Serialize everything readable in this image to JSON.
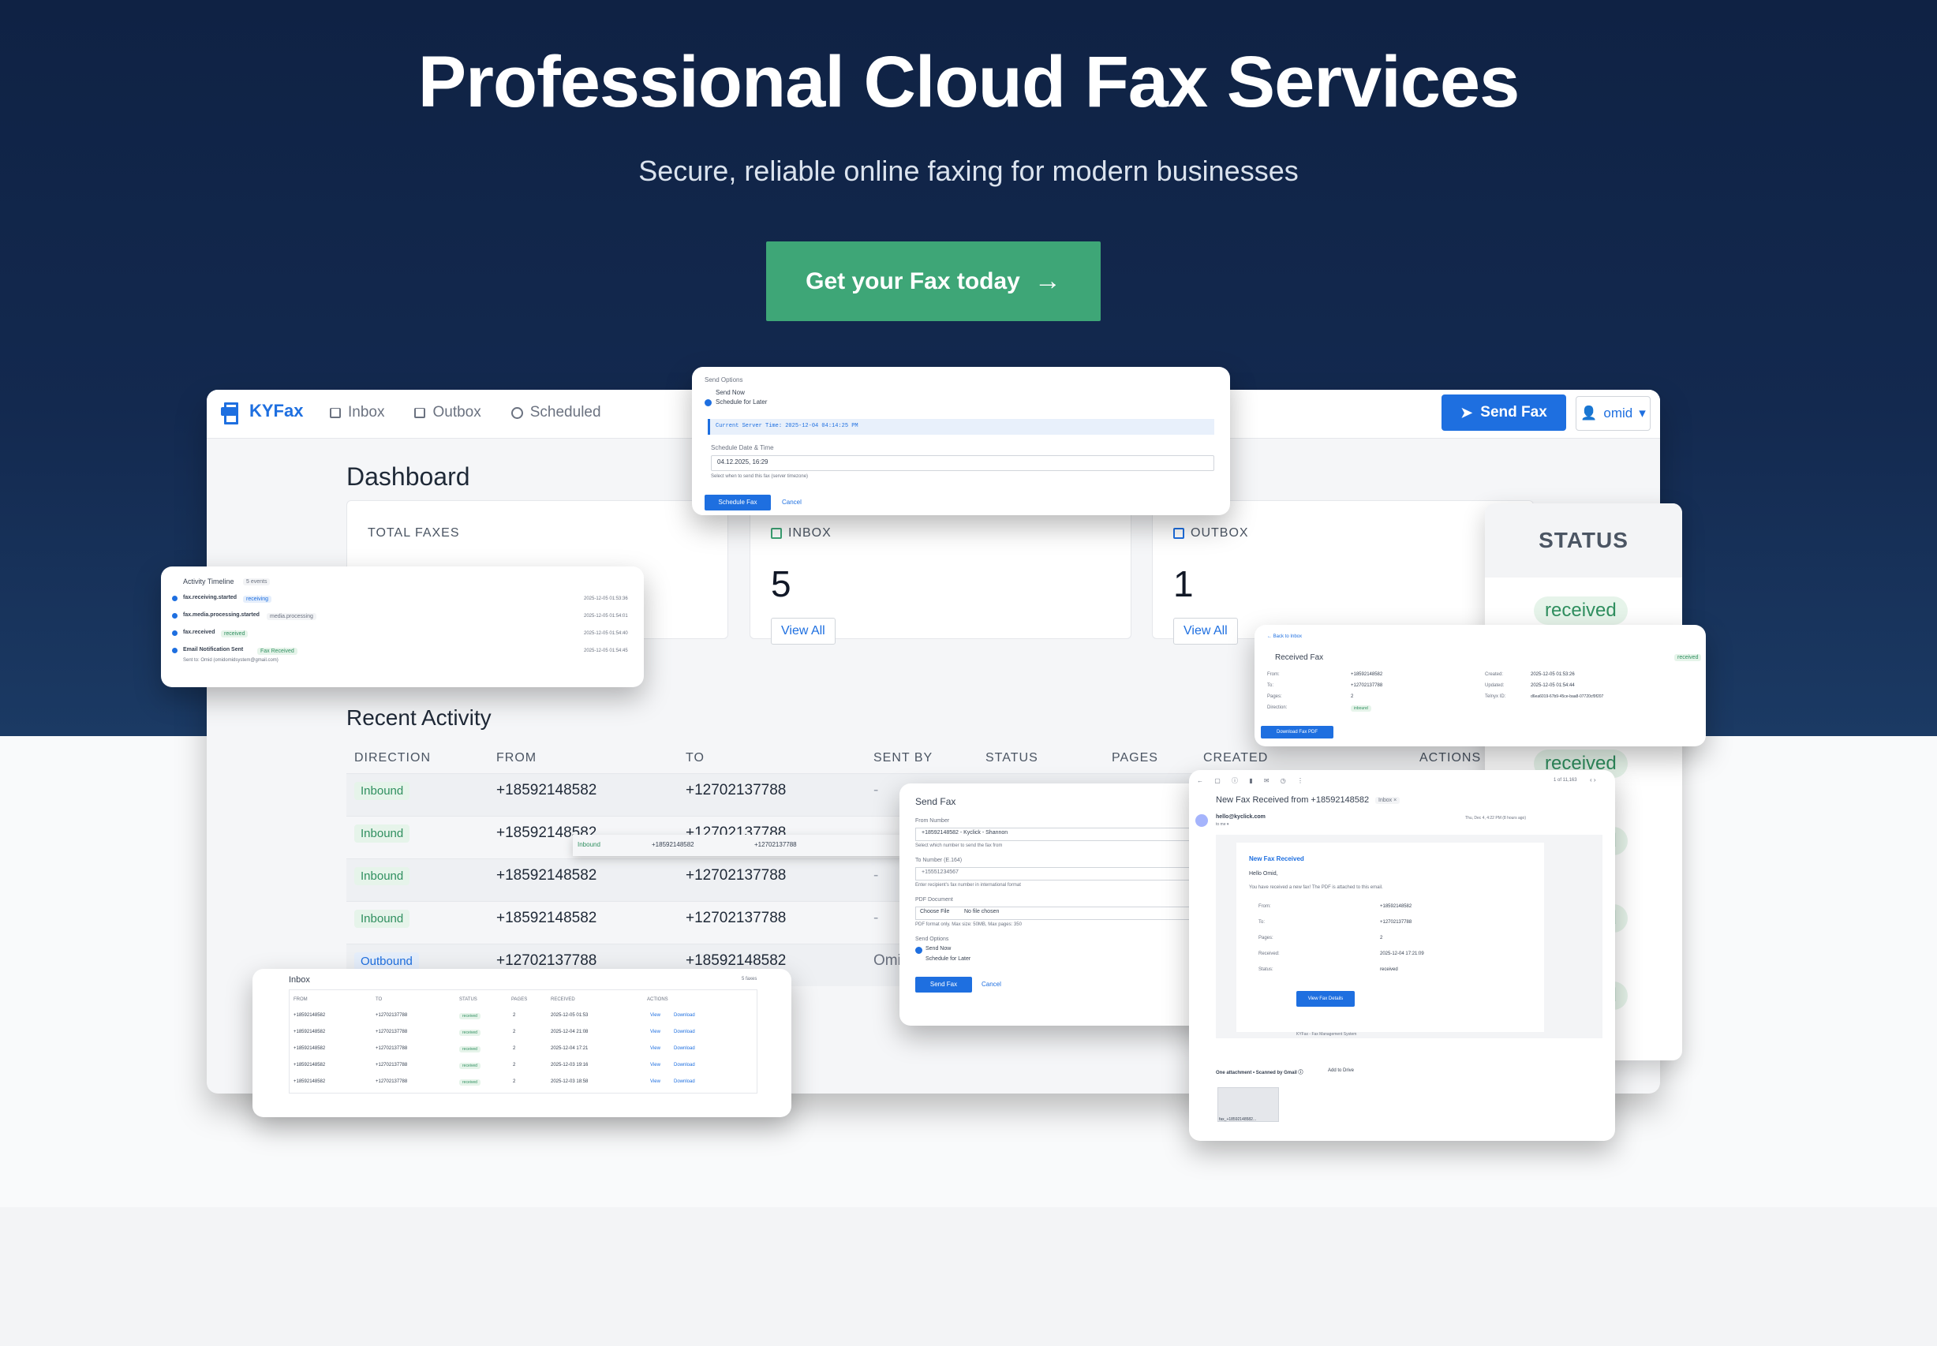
{
  "hero": {
    "title": "Professional Cloud Fax Services",
    "subtitle": "Secure, reliable online faxing for modern businesses",
    "cta_label": "Get your Fax today",
    "cta_icon": "arrow-right-icon",
    "accent_color": "#3ea677"
  },
  "dashboard": {
    "brand": "KYFax",
    "nav": [
      "Inbox",
      "Outbox",
      "Scheduled"
    ],
    "send_fax_label": "Send Fax",
    "user_label": "omid",
    "title": "Dashboard",
    "stats": [
      {
        "label": "TOTAL FAXES",
        "value": ""
      },
      {
        "label": "INBOX",
        "value": "5",
        "link": "View All"
      },
      {
        "label": "OUTBOX",
        "value": "1",
        "link": "View All"
      }
    ],
    "recent_activity_title": "Recent Activity",
    "columns": [
      "DIRECTION",
      "FROM",
      "TO",
      "SENT BY",
      "STATUS",
      "PAGES",
      "CREATED",
      "ACTIONS"
    ],
    "rows": [
      {
        "direction": "Inbound",
        "from": "+18592148582",
        "to": "+12702137788",
        "sent_by": "-"
      },
      {
        "direction": "Inbound",
        "from": "+18592148582",
        "to": "+12702137788",
        "sent_by": ""
      },
      {
        "direction": "Inbound",
        "from": "+18592148582",
        "to": "+12702137788",
        "sent_by": "-"
      },
      {
        "direction": "Inbound",
        "from": "+18592148582",
        "to": "+12702137788",
        "sent_by": "-"
      },
      {
        "direction": "Outbound",
        "from": "+12702137788",
        "to": "+18592148582",
        "sent_by": "Omid"
      }
    ],
    "status_header": "STATUS",
    "status_values": [
      "received",
      "received",
      "received",
      "received",
      "received"
    ]
  },
  "schedule_card": {
    "heading": "Send Options",
    "send_now": "Send Now",
    "schedule_later": "Schedule for Later",
    "server_time": "Current Server Time: 2025-12-04 04:14:25 PM",
    "date_label": "Schedule Date & Time",
    "date_value": "04.12.2025, 16:29",
    "hint": "Select when to send this fax (server timezone)",
    "submit": "Schedule Fax",
    "cancel": "Cancel"
  },
  "timeline_card": {
    "title": "Activity Timeline",
    "count": "5 events",
    "events": [
      {
        "name": "fax.receiving.started",
        "tag": "receiving",
        "time": "2025-12-05 01:53:36"
      },
      {
        "name": "fax.media.processing.started",
        "tag": "media.processing",
        "time": "2025-12-05 01:54:01"
      },
      {
        "name": "fax.received",
        "tag": "received",
        "time": "2025-12-05 01:54:40"
      },
      {
        "name": "Email Notification Sent",
        "tag": "Fax Received",
        "time": "2025-12-05 01:54:45"
      }
    ],
    "sent_to": "Sent to: Omid (omidomidsystem@gmail.com)"
  },
  "received_card": {
    "back": "← Back to Inbox",
    "title": "Received Fax",
    "status": "received",
    "from_label": "From:",
    "from": "+18592148582",
    "to_label": "To:",
    "to": "+12702137788",
    "pages_label": "Pages:",
    "pages": "2",
    "direction_label": "Direction:",
    "direction": "inbound",
    "created_label": "Created:",
    "created": "2025-12-05 01:53:26",
    "updated_label": "Updated:",
    "updated": "2025-12-05 01:54:44",
    "telnyx_label": "Telnyx ID:",
    "telnyx": "d6ea6019-67b9-45ce-baa8-07720cf9f207",
    "download": "Download Fax PDF"
  },
  "inbox_card": {
    "title": "Inbox",
    "count": "5 faxes",
    "columns": [
      "FROM",
      "TO",
      "STATUS",
      "PAGES",
      "RECEIVED",
      "ACTIONS"
    ],
    "rows": [
      {
        "from": "+18592148582",
        "to": "+12702137788",
        "status": "received",
        "pages": "2",
        "received": "2025-12-05 01:53",
        "view": "View",
        "download": "Download"
      },
      {
        "from": "+18592148582",
        "to": "+12702137788",
        "status": "received",
        "pages": "2",
        "received": "2025-12-04 21:08",
        "view": "View",
        "download": "Download"
      },
      {
        "from": "+18592148582",
        "to": "+12702137788",
        "status": "received",
        "pages": "2",
        "received": "2025-12-04 17:21",
        "view": "View",
        "download": "Download"
      },
      {
        "from": "+18592148582",
        "to": "+12702137788",
        "status": "received",
        "pages": "2",
        "received": "2025-12-03 19:16",
        "view": "View",
        "download": "Download"
      },
      {
        "from": "+18592148582",
        "to": "+12702137788",
        "status": "received",
        "pages": "2",
        "received": "2025-12-03 18:58",
        "view": "View",
        "download": "Download"
      }
    ]
  },
  "popup_row": {
    "direction": "Inbound",
    "from": "+18592148582",
    "to": "+12702137788"
  },
  "sendfax_card": {
    "title": "Send Fax",
    "from_label": "From Number",
    "from_value": "+18592148582 - Kyclick - Shannon",
    "from_hint": "Select which number to send the fax from",
    "to_label": "To Number (E.164)",
    "to_value": "+15551234567",
    "to_hint": "Enter recipient's fax number in international format",
    "pdf_label": "PDF Document",
    "choose": "Choose File",
    "no_file": "No file chosen",
    "pdf_hint": "PDF format only. Max size: 50MB, Max pages: 350",
    "options_label": "Send Options",
    "send_now": "Send Now",
    "schedule": "Schedule for Later",
    "submit": "Send Fax",
    "cancel": "Cancel"
  },
  "email_card": {
    "pager": "1 of 11,163",
    "subject": "New Fax Received from +18592148582",
    "label": "Inbox ×",
    "sender": "hello@kyclick.com",
    "to": "to me ▾",
    "date": "Thu, Dec 4, 4:22 PM (8 hours ago)",
    "heading": "New Fax Received",
    "greeting": "Hello Omid,",
    "intro": "You have received a new fax! The PDF is attached to this email.",
    "from_label": "From:",
    "from": "+18592148582",
    "to_label": "To:",
    "to_num": "+12702137788",
    "pages_label": "Pages:",
    "pages": "2",
    "received_label": "Received:",
    "received": "2025-12-04 17:21:09",
    "status_label": "Status:",
    "status": "received",
    "button": "View Fax Details",
    "footer": "KYFax - Fax Management System",
    "attach": "One attachment • Scanned by Gmail ⓘ",
    "drive": "Add to Drive",
    "file": "fax_+18592148582..."
  }
}
